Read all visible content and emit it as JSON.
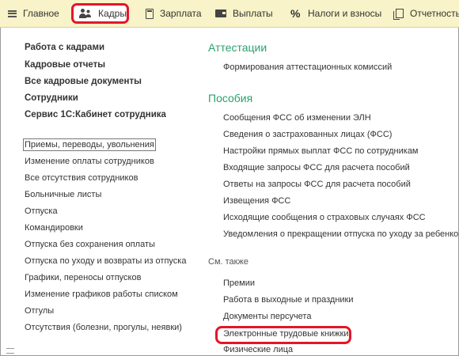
{
  "topbar": {
    "tabs": [
      {
        "label": "Главное",
        "icon": "menu-icon"
      },
      {
        "label": "Кадры",
        "icon": "people-icon"
      },
      {
        "label": "Зарплата",
        "icon": "calculator-icon"
      },
      {
        "label": "Выплаты",
        "icon": "wallet-icon"
      },
      {
        "label": "Налоги и взносы",
        "icon": "percent-icon"
      },
      {
        "label": "Отчетность",
        "icon": "documents-icon"
      }
    ],
    "percent_glyph": "%"
  },
  "left": {
    "bold_links": [
      "Работа с кадрами",
      "Кадровые отчеты",
      "Все кадровые документы",
      "Сотрудники",
      "Сервис 1С:Кабинет сотрудника"
    ],
    "links": [
      "Приемы, переводы, увольнения",
      "Изменение оплаты сотрудников",
      "Все отсутствия сотрудников",
      "Больничные листы",
      "Отпуска",
      "Командировки",
      "Отпуска без сохранения оплаты",
      "Отпуска по уходу и возвраты из отпуска",
      "Графики, переносы отпусков",
      "Изменение графиков работы списком",
      "Отгулы",
      "Отсутствия (болезни, прогулы, неявки)"
    ]
  },
  "right": {
    "attestation": {
      "title": "Аттестации",
      "links": [
        "Формирования аттестационных комиссий"
      ]
    },
    "benefits": {
      "title": "Пособия",
      "links": [
        "Сообщения ФСС об изменении ЭЛН",
        "Сведения о застрахованных лицах (ФСС)",
        "Настройки прямых выплат ФСС по сотрудникам",
        "Входящие запросы ФСС для расчета пособий",
        "Ответы на запросы ФСС для расчета пособий",
        "Извещения ФСС",
        "Исходящие сообщения о страховых случаях ФСС",
        "Уведомления о прекращении отпуска по уходу за ребенком"
      ]
    },
    "see_also": {
      "title": "См. также",
      "links": [
        "Премии",
        "Работа в выходные и праздники",
        "Документы персучета",
        "Электронные трудовые книжки",
        "Физические лица"
      ]
    }
  },
  "colors": {
    "topbar_bg": "#f8f3c8",
    "section_header": "#27a36e",
    "highlight": "#e3162b"
  }
}
